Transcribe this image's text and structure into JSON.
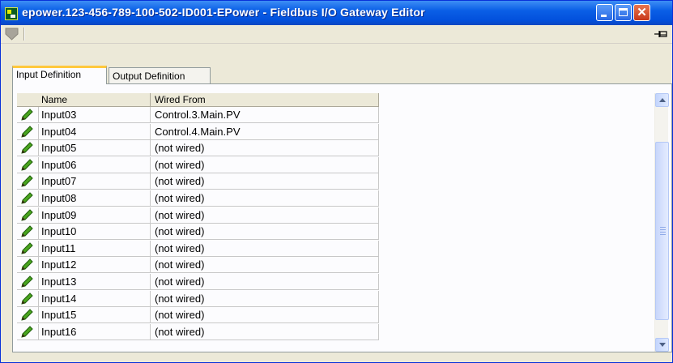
{
  "window": {
    "title": "epower.123-456-789-100-502-ID001-EPower - Fieldbus I/O Gateway Editor",
    "buttons": {
      "minimize": "minimize",
      "maximize": "maximize",
      "close": "close"
    }
  },
  "toolbar": {
    "icons": [
      "shield-icon",
      "pin-icon"
    ]
  },
  "tabs": [
    {
      "label": "Input Definition",
      "active": true
    },
    {
      "label": "Output Definition",
      "active": false
    }
  ],
  "grid": {
    "columns": [
      "Name",
      "Wired From"
    ],
    "rows": [
      {
        "name": "Input03",
        "wired_from": "Control.3.Main.PV"
      },
      {
        "name": "Input04",
        "wired_from": "Control.4.Main.PV"
      },
      {
        "name": "Input05",
        "wired_from": "(not wired)"
      },
      {
        "name": "Input06",
        "wired_from": "(not wired)"
      },
      {
        "name": "Input07",
        "wired_from": "(not wired)"
      },
      {
        "name": "Input08",
        "wired_from": "(not wired)"
      },
      {
        "name": "Input09",
        "wired_from": "(not wired)"
      },
      {
        "name": "Input10",
        "wired_from": "(not wired)"
      },
      {
        "name": "Input11",
        "wired_from": "(not wired)"
      },
      {
        "name": "Input12",
        "wired_from": "(not wired)"
      },
      {
        "name": "Input13",
        "wired_from": "(not wired)"
      },
      {
        "name": "Input14",
        "wired_from": "(not wired)"
      },
      {
        "name": "Input15",
        "wired_from": "(not wired)"
      },
      {
        "name": "Input16",
        "wired_from": "(not wired)"
      }
    ]
  },
  "colors": {
    "titlebar": "#0a5fe6",
    "active_tab_accent": "#ffc83c",
    "pencil": "#3a9a1a"
  }
}
